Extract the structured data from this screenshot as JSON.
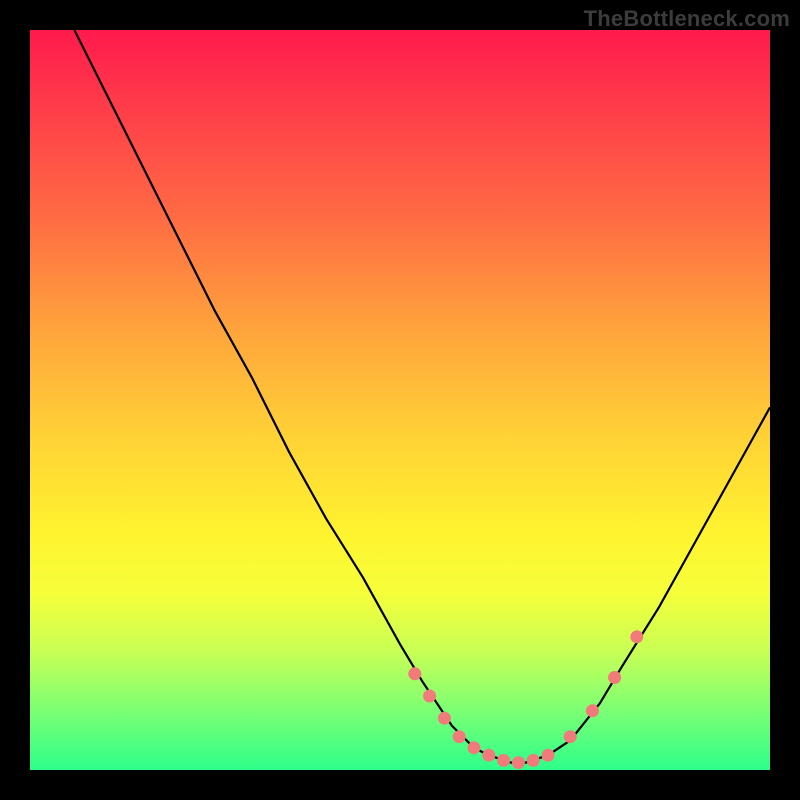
{
  "watermark": "TheBottleneck.com",
  "colors": {
    "background": "#000000",
    "gradient_top": "#ff1a4d",
    "gradient_mid": "#fff32f",
    "gradient_bottom": "#2dff8a",
    "curve": "#000000",
    "marker_fill": "#f17b7b",
    "marker_stroke": "#8a3a3a"
  },
  "chart_data": {
    "type": "line",
    "title": "",
    "xlabel": "",
    "ylabel": "",
    "xlim": [
      0,
      100
    ],
    "ylim": [
      0,
      100
    ],
    "x": [
      6,
      10,
      15,
      20,
      25,
      30,
      35,
      40,
      45,
      50,
      53,
      55,
      57,
      60,
      62,
      65,
      67,
      70,
      73,
      77,
      80,
      85,
      90,
      95,
      100
    ],
    "y": [
      100,
      92,
      82,
      72,
      62,
      53,
      43,
      34,
      26,
      17,
      12,
      9,
      6,
      3,
      2,
      1,
      1,
      2,
      4,
      9,
      14,
      22,
      31,
      40,
      49
    ],
    "markers_x": [
      52,
      54,
      56,
      58,
      60,
      62,
      64,
      66,
      68,
      70,
      73,
      76,
      79,
      82
    ],
    "markers_y": [
      13,
      10,
      7,
      4.5,
      3,
      2,
      1.3,
      1,
      1.3,
      2,
      4.5,
      8,
      12.5,
      18
    ],
    "grid": false,
    "legend": false
  }
}
